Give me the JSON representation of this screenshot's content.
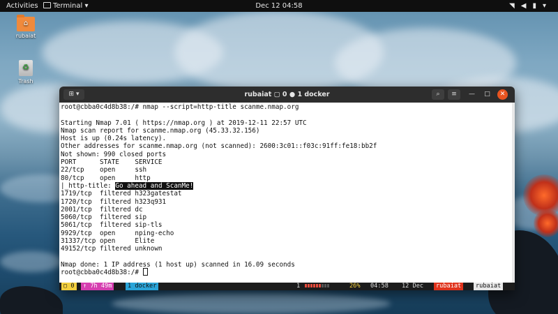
{
  "topbar": {
    "activities": "Activities",
    "app_menu": "Terminal ▾",
    "clock": "Dec 12  04:58",
    "tray_icons": [
      "wifi-icon",
      "volume-icon",
      "battery-icon",
      "system-menu-icon"
    ]
  },
  "desktop": {
    "home_folder_label": "rubaiat",
    "trash_label": "Trash"
  },
  "terminal": {
    "title": "rubaiat ▢ 0 ● 1 docker",
    "lines": [
      "root@cbba0c4d8b38:/# nmap --script=http-title scanme.nmap.org",
      "",
      "Starting Nmap 7.01 ( https://nmap.org ) at 2019-12-11 22:57 UTC",
      "Nmap scan report for scanme.nmap.org (45.33.32.156)",
      "Host is up (0.24s latency).",
      "Other addresses for scanme.nmap.org (not scanned): 2600:3c01::f03c:91ff:fe18:bb2f",
      "Not shown: 990 closed ports",
      "PORT      STATE    SERVICE",
      "22/tcp    open     ssh",
      "80/tcp    open     http",
      "|_http-title: ",
      "1719/tcp  filtered h323gatestat",
      "1720/tcp  filtered h323q931",
      "2001/tcp  filtered dc",
      "5060/tcp  filtered sip",
      "5061/tcp  filtered sip-tls",
      "9929/tcp  open     nping-echo",
      "31337/tcp open     Elite",
      "49152/tcp filtered unknown",
      "",
      "Nmap done: 1 IP address (1 host up) scanned in 16.09 seconds",
      "root@cbba0c4d8b38:/# "
    ],
    "http_title_value": "Go ahead and ScanMe!"
  },
  "statusbar": {
    "session": "▢ 0",
    "uptime": "↑ 7h 49m",
    "window": "1 docker",
    "window_index": "1",
    "load_bar_filled": 6,
    "load_bar_total": 9,
    "percent": "26%",
    "time": "04:58",
    "date": "12 Dec",
    "host": "rubaiat",
    "user": "rubaiat"
  },
  "colors": {
    "titlebar": "#2d2d2d",
    "close_button": "#e95420",
    "session_tag": "#f4d03f",
    "uptime_tag": "#d63fb0",
    "window_tag": "#2aa4d8",
    "host_tag": "#e0331c"
  }
}
